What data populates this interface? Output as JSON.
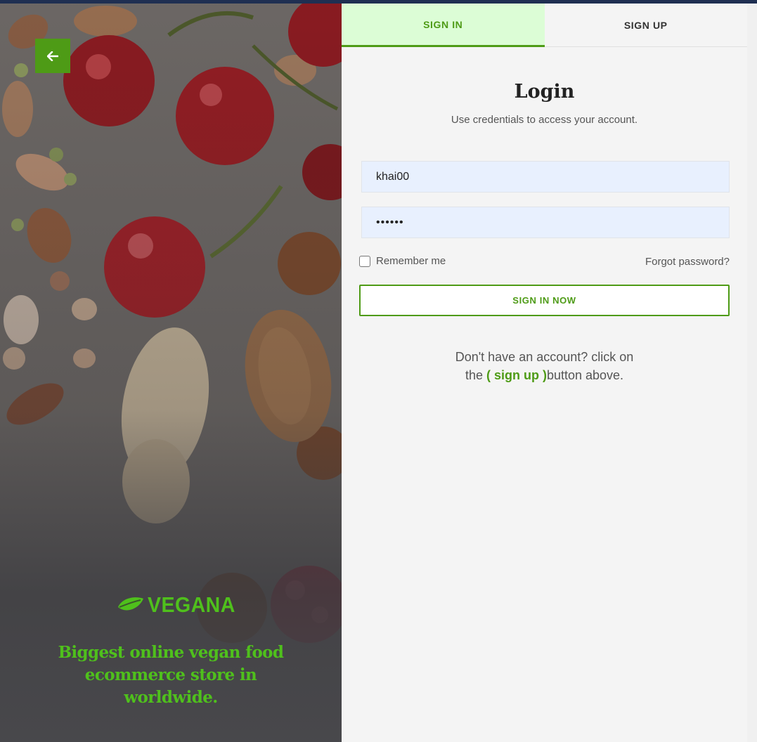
{
  "brand": {
    "name": "VEGANA",
    "tagline": "Biggest online vegan food ecommerce store in worldwide.",
    "accent_color": "#4e9b16",
    "logo_color": "#4fc01c"
  },
  "nav": {
    "back_icon": "arrow-left-icon"
  },
  "tabs": [
    {
      "label": "SIGN IN",
      "active": true
    },
    {
      "label": "SIGN UP",
      "active": false
    }
  ],
  "login": {
    "title": "Login",
    "subtitle": "Use credentials to access your account.",
    "username_value": "khai00",
    "password_value": "••••••",
    "remember_label": "Remember me",
    "forgot_label": "Forgot password?",
    "submit_label": "SIGN IN NOW"
  },
  "signup_note": {
    "line1": "Don't have an account? click on",
    "prefix": "the ",
    "link": "( sign up )",
    "suffix": "button above."
  }
}
